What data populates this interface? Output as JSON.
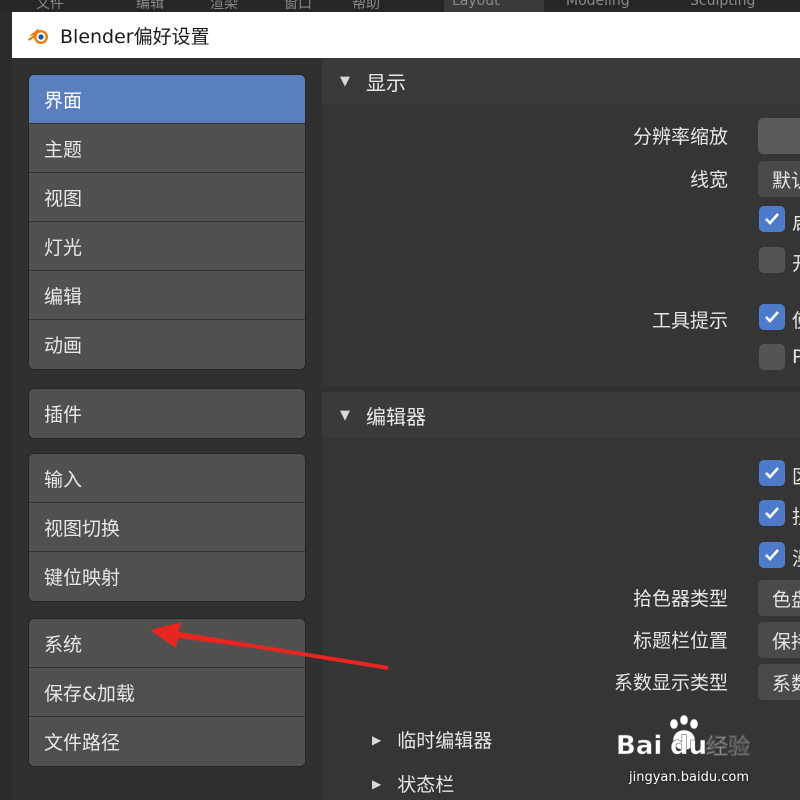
{
  "background_app": {
    "menu_items": [
      "文件",
      "编辑",
      "渲染",
      "窗口",
      "帮助"
    ],
    "workspace_tabs": [
      "Layout",
      "Modeling",
      "Sculpting"
    ]
  },
  "window": {
    "title": "Blender偏好设置"
  },
  "sidebar": {
    "groups": [
      {
        "items": [
          "界面",
          "主题",
          "视图",
          "灯光",
          "编辑",
          "动画"
        ]
      },
      {
        "items": [
          "插件"
        ]
      },
      {
        "items": [
          "输入",
          "视图切换",
          "键位映射"
        ]
      },
      {
        "items": [
          "系统",
          "保存&加载",
          "文件路径"
        ]
      }
    ],
    "active_item": "界面"
  },
  "content": {
    "display_panel": {
      "title": "显示",
      "resolution_scale_label": "分辨率缩放",
      "line_width_label": "线宽",
      "line_width_value": "默认",
      "check1_label": "启",
      "check2_label": "开",
      "tooltips_label": "工具提示",
      "check3_label": "使",
      "check4_label": "Py"
    },
    "editors_panel": {
      "title": "编辑器",
      "check1_label": "区",
      "check2_label": "拐",
      "check3_label": "漫",
      "color_picker_label": "拾色器类型",
      "color_picker_value": "色盘",
      "header_pos_label": "标题栏位置",
      "header_pos_value": "保持",
      "factor_display_label": "系数显示类型",
      "factor_display_value": "系数",
      "sub_items": [
        "临时编辑器",
        "状态栏"
      ]
    }
  },
  "watermark": {
    "url": "jingyan.baidu.com",
    "brand_suffix": "经验"
  },
  "colors": {
    "accent": "#5a7fbf",
    "checkbox_on": "#4d7ac9",
    "arrow": "#e8261f"
  }
}
